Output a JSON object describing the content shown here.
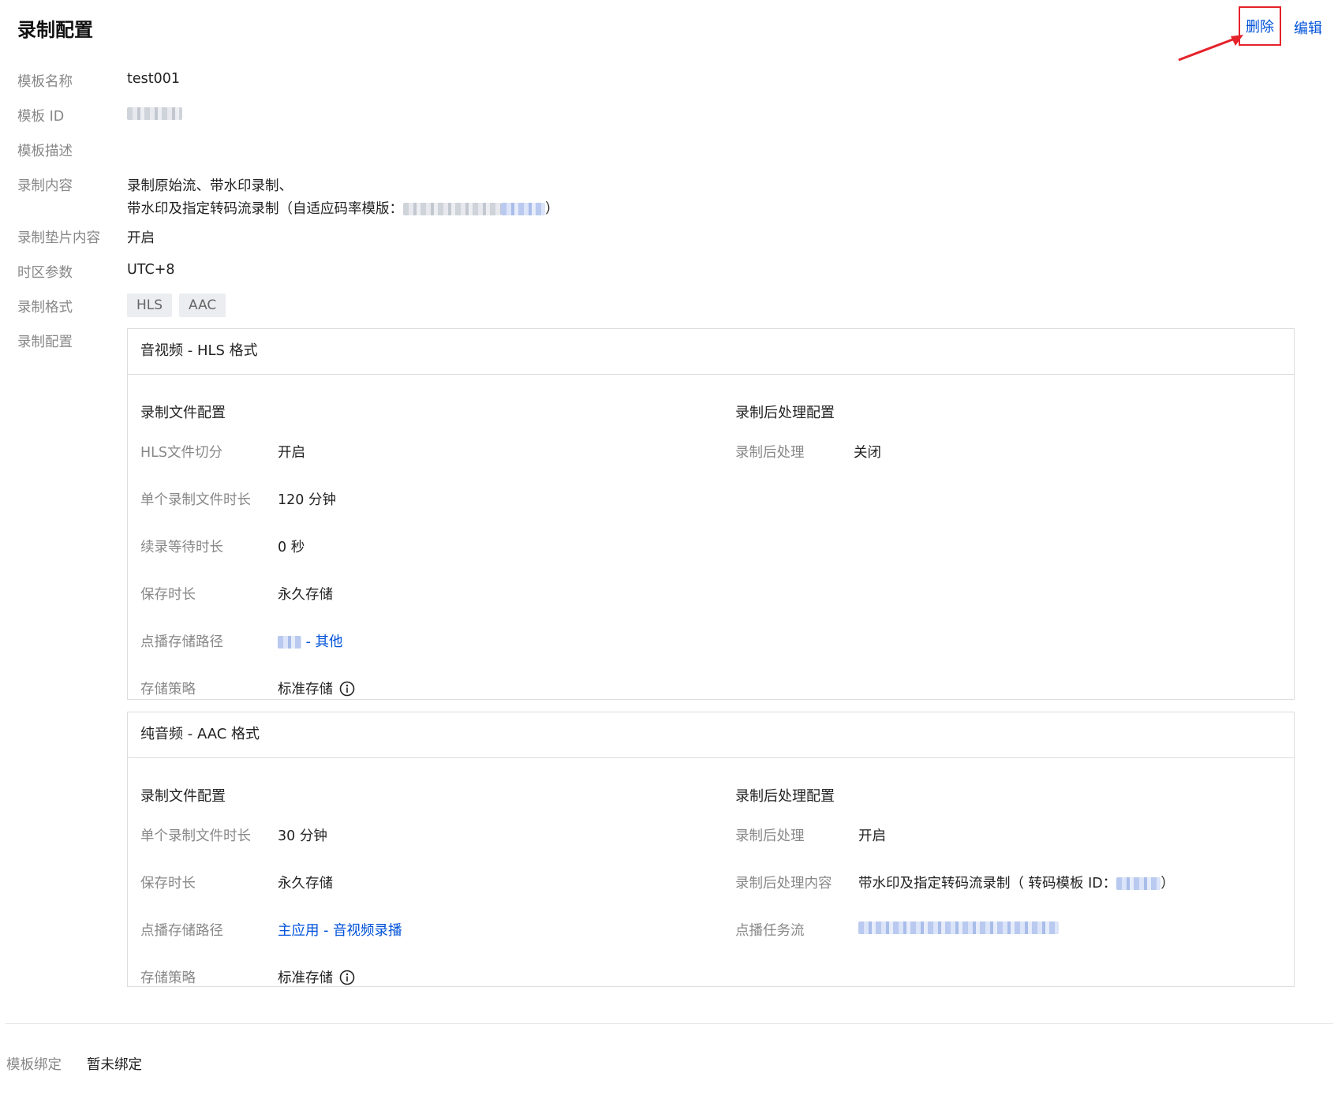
{
  "header": {
    "title": "录制配置",
    "delete_label": "删除",
    "edit_label": "编辑"
  },
  "info": {
    "name_label": "模板名称",
    "name_value": "test001",
    "id_label": "模板 ID",
    "desc_label": "模板描述",
    "content_label": "录制内容",
    "content_line1": "录制原始流、带水印录制、",
    "content_line2": "带水印及指定转码流录制（自适应码率模版：",
    "content_line2_end": "）",
    "padding_label": "录制垫片内容",
    "padding_value": "开启",
    "tz_label": "时区参数",
    "tz_value": "UTC+8",
    "format_label": "录制格式",
    "formats": [
      "HLS",
      "AAC"
    ],
    "config_label": "录制配置"
  },
  "hls_card": {
    "title": "音视频 - HLS 格式",
    "file_cfg_title": "录制文件配置",
    "post_cfg_title": "录制后处理配置",
    "rows": [
      {
        "label": "HLS文件切分",
        "value": "开启"
      },
      {
        "label": "单个录制文件时长",
        "value": "120 分钟"
      },
      {
        "label": "续录等待时长",
        "value": "0 秒"
      },
      {
        "label": "保存时长",
        "value": "永久存储"
      },
      {
        "label": "点播存储路径",
        "value": " - 其他"
      },
      {
        "label": "存储策略",
        "value": "标准存储"
      }
    ],
    "post_rows": [
      {
        "label": "录制后处理",
        "value": "关闭"
      }
    ]
  },
  "aac_card": {
    "title": "纯音频 - AAC 格式",
    "file_cfg_title": "录制文件配置",
    "post_cfg_title": "录制后处理配置",
    "rows": [
      {
        "label": "单个录制文件时长",
        "value": "30 分钟"
      },
      {
        "label": "保存时长",
        "value": "永久存储"
      },
      {
        "label": "点播存储路径",
        "value": "主应用 - 音视频录播"
      },
      {
        "label": "存储策略",
        "value": "标准存储"
      }
    ],
    "post_rows": [
      {
        "label": "录制后处理",
        "value": "开启"
      },
      {
        "label": "录制后处理内容",
        "value": "带水印及指定转码流录制（ 转码模板 ID：",
        "value_end": "）"
      },
      {
        "label": "点播任务流",
        "value": ""
      }
    ]
  },
  "binding": {
    "label": "模板绑定",
    "value": "暂未绑定"
  },
  "colors": {
    "link": "#0052d9",
    "highlight_box": "#e5222a",
    "label": "#888888"
  }
}
